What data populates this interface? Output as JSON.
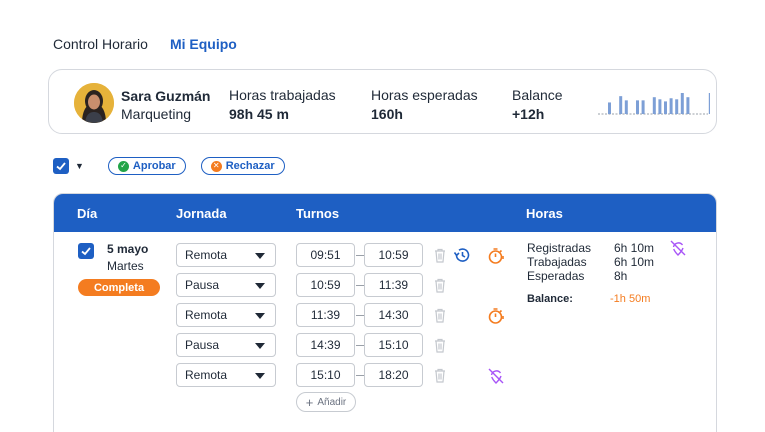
{
  "tabs": [
    "Control Horario",
    "Mi Equipo"
  ],
  "user": {
    "name": "Sara Guzmán",
    "department": "Marqueting"
  },
  "stats": [
    {
      "label": "Horas trabajadas",
      "value": "98h 45 m"
    },
    {
      "label": "Horas esperadas",
      "value": "160h"
    },
    {
      "label": "Balance",
      "value": "+12h"
    }
  ],
  "sparkline": [
    0.55,
    0.0,
    0.85,
    0.65,
    0.0,
    0.65,
    0.65,
    0.0,
    0.8,
    0.7,
    0.6,
    0.75,
    0.7,
    1.0,
    0.8,
    0.0,
    0.0,
    0.0,
    1.0
  ],
  "bulk": {
    "approve_label": "Aprobar",
    "reject_label": "Rechazar"
  },
  "table": {
    "headers": {
      "day": "Día",
      "shift_type": "Jornada",
      "shifts": "Turnos",
      "hours": "Horas"
    },
    "row": {
      "date": "5 mayo",
      "weekday": "Martes",
      "status": "Completa",
      "shifts": [
        {
          "type": "Remota",
          "start": "09:51",
          "end": "10:59",
          "icons": [
            "history-icon",
            "timer-icon"
          ]
        },
        {
          "type": "Pausa",
          "start": "10:59",
          "end": "11:39",
          "icons": []
        },
        {
          "type": "Remota",
          "start": "11:39",
          "end": "14:30",
          "icons": [
            "timer-icon"
          ]
        },
        {
          "type": "Pausa",
          "start": "14:39",
          "end": "15:10",
          "icons": []
        },
        {
          "type": "Remota",
          "start": "15:10",
          "end": "18:20",
          "icons": [
            "no-location-icon"
          ]
        }
      ],
      "add_label": "Añadir",
      "hours": [
        {
          "label": "Registradas",
          "value": "6h 10m"
        },
        {
          "label": "Trabajadas",
          "value": "6h 10m"
        },
        {
          "label": "Esperadas",
          "value": "8h"
        }
      ],
      "balance_label": "Balance:",
      "balance_value": "-1h 50m"
    }
  },
  "colors": {
    "primary": "#1e5fc3",
    "orange": "#f47c20",
    "purple": "#a855f7",
    "green": "#22a447"
  }
}
